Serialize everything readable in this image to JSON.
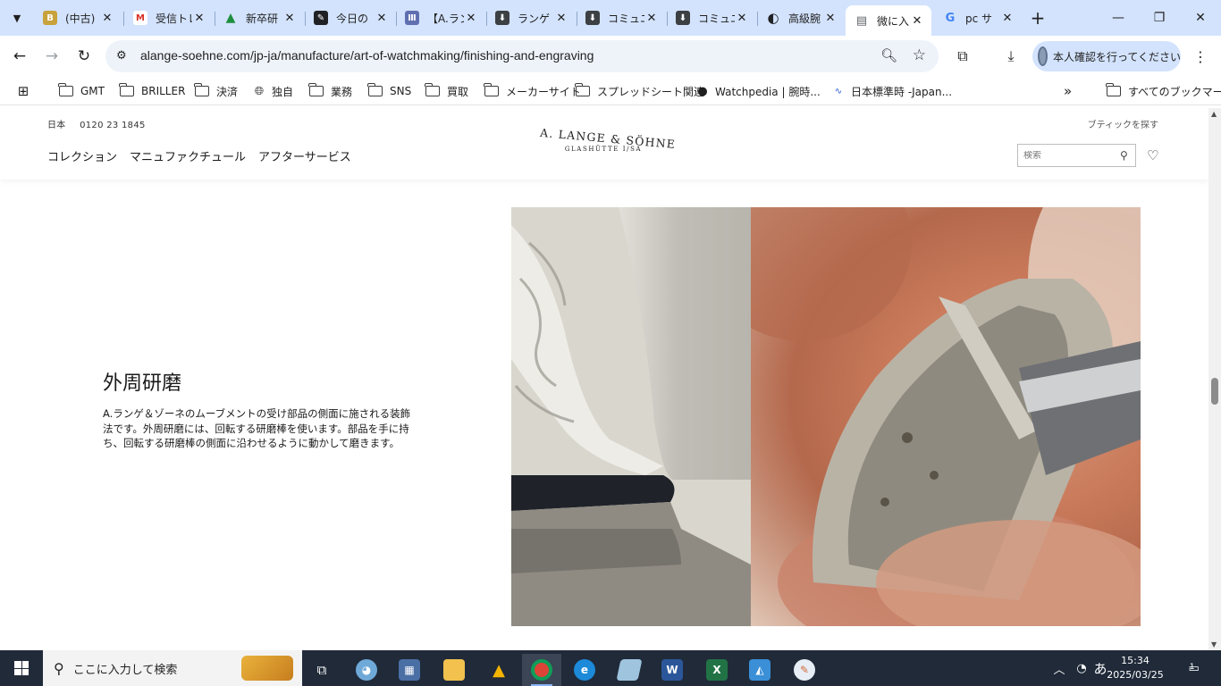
{
  "browser": {
    "tabs": [
      {
        "title": "(中古)",
        "favicon": "B",
        "color": "#c8a23a"
      },
      {
        "title": "受信トレイ",
        "favicon": "M",
        "color": "#d93025"
      },
      {
        "title": "新卒研",
        "favicon": "▲",
        "color": "#1e8e3e"
      },
      {
        "title": "今日の",
        "favicon": "✎",
        "color": "#202124"
      },
      {
        "title": "【A.ラン",
        "favicon": "Ⅲ",
        "color": "#5f6fb0"
      },
      {
        "title": "ランゲ",
        "favicon": "⬇",
        "color": "#3c4043"
      },
      {
        "title": "コミュニ",
        "favicon": "⬇",
        "color": "#3c4043"
      },
      {
        "title": "コミュニ",
        "favicon": "⬇",
        "color": "#3c4043"
      },
      {
        "title": "高級腕",
        "favicon": "◐",
        "color": "#202124"
      },
      {
        "title": "微に入",
        "favicon": "▤",
        "color": "#5f6368"
      },
      {
        "title": "pc サ",
        "favicon": "G",
        "color": "#4285f4"
      }
    ],
    "active_tab_index": 9,
    "url": "alange-soehne.com/jp-ja/manufacture/art-of-watchmaking/finishing-and-engraving",
    "profile_label": "本人確認を行ってください",
    "window_controls": {
      "minimize": "—",
      "maximize": "❐",
      "close": "✕"
    }
  },
  "bookmarks": {
    "items": [
      {
        "label": "GMT",
        "icon": "folder"
      },
      {
        "label": "BRILLER",
        "icon": "folder"
      },
      {
        "label": "決済",
        "icon": "folder"
      },
      {
        "label": "独自",
        "icon": "globe-icon"
      },
      {
        "label": "業務",
        "icon": "folder"
      },
      {
        "label": "SNS",
        "icon": "folder"
      },
      {
        "label": "買取",
        "icon": "folder"
      },
      {
        "label": "メーカーサイト",
        "icon": "folder"
      },
      {
        "label": "スプレッドシート関連",
        "icon": "folder"
      },
      {
        "label": "Watchpedia | 腕時...",
        "icon": "watchpedia-icon"
      },
      {
        "label": "日本標準時 -Japan...",
        "icon": "nict-icon"
      }
    ],
    "overflow": "»",
    "all_bookmarks": "すべてのブックマーク"
  },
  "site": {
    "country": "日本",
    "phone": "0120 23 1845",
    "boutique_link": "ブティックを探す",
    "nav": [
      "コレクション",
      "マニュファクチュール",
      "アフターサービス"
    ],
    "logo_line1": "A. LANGE & SÖHNE",
    "logo_line2": "GLASHÜTTE I/SA",
    "search_placeholder": "検索"
  },
  "content": {
    "title": "外周研磨",
    "body": "A.ランゲ＆ゾーネのムーブメントの受け部品の側面に施される装飾法です。外周研磨には、回転する研磨棒を使います。部品を手に持ち、回転する研磨棒の側面に沿わせるように動かして磨きます。"
  },
  "taskbar": {
    "search_placeholder": "ここに入力して検索",
    "ime": "あ",
    "time": "15:34",
    "date": "2025/03/25",
    "notifications": "1"
  }
}
